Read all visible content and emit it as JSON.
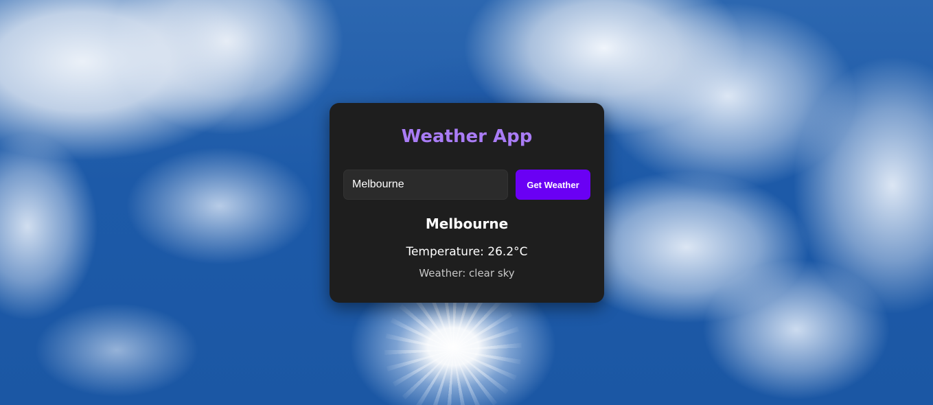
{
  "app": {
    "title": "Weather App"
  },
  "search": {
    "value": "Melbourne",
    "button_label": "Get Weather"
  },
  "result": {
    "city": "Melbourne",
    "temperature": "Temperature: 26.2°C",
    "description": "Weather: clear sky"
  },
  "colors": {
    "title_accent": "#a97cf5",
    "button_bg": "#6a00f4",
    "card_bg": "#1e1e1e",
    "input_bg": "#2b2b2b"
  }
}
